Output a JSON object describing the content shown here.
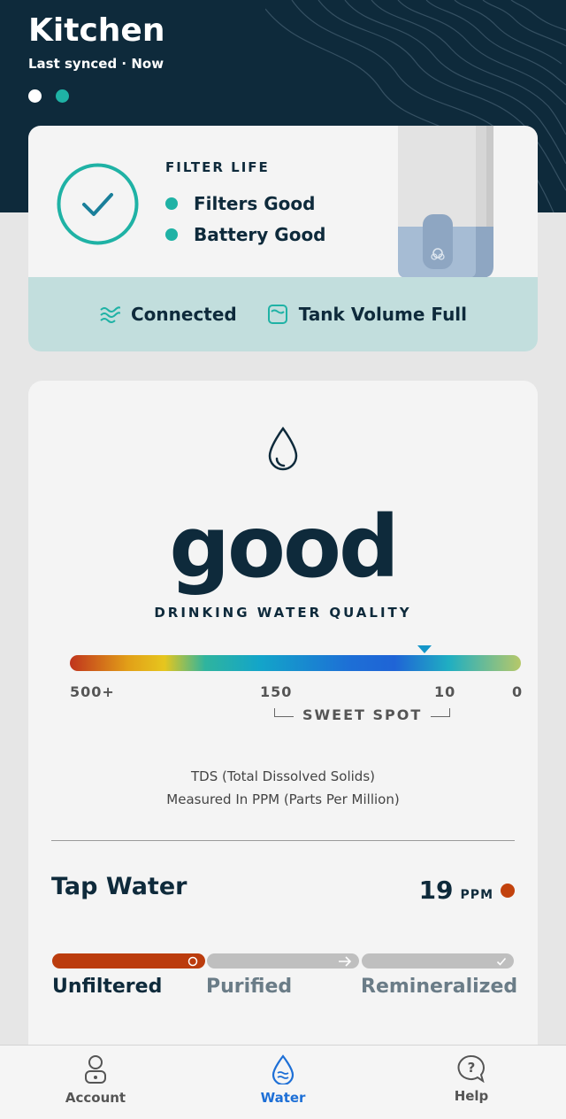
{
  "header": {
    "title": "Kitchen",
    "sync_status": "Last synced · Now",
    "page_dots": [
      "inactive",
      "active"
    ]
  },
  "filter_card": {
    "title": "FILTER LIFE",
    "statuses": [
      {
        "label": "Filters Good"
      },
      {
        "label": "Battery Good"
      }
    ],
    "connection": {
      "connected_label": "Connected",
      "tank_label": "Tank Volume Full"
    }
  },
  "quality": {
    "rating": "good",
    "subtitle": "DRINKING WATER QUALITY",
    "scale_ticks": [
      "500+",
      "150",
      "10",
      "0"
    ],
    "sweet_spot_label": "SWEET SPOT",
    "tds_line1": "TDS (Total Dissolved Solids)",
    "tds_line2": "Measured In PPM (Parts Per Million)"
  },
  "tap_water": {
    "title": "Tap Water",
    "ppm_value": "19",
    "ppm_unit": "PPM",
    "stages": [
      {
        "label": "Unfiltered",
        "active": true
      },
      {
        "label": "Purified",
        "active": false
      },
      {
        "label": "Remineralized",
        "active": false
      }
    ]
  },
  "bottom_nav": {
    "items": [
      {
        "label": "Account",
        "icon": "account-icon"
      },
      {
        "label": "Water",
        "icon": "water-drop-icon",
        "active": true
      },
      {
        "label": "Help",
        "icon": "help-icon"
      }
    ]
  },
  "colors": {
    "navy": "#0e2a3b",
    "teal": "#1fb2a5",
    "band": "#c2dedd",
    "alert_orange": "#bb3c0d",
    "active_blue": "#1d6fd6"
  }
}
